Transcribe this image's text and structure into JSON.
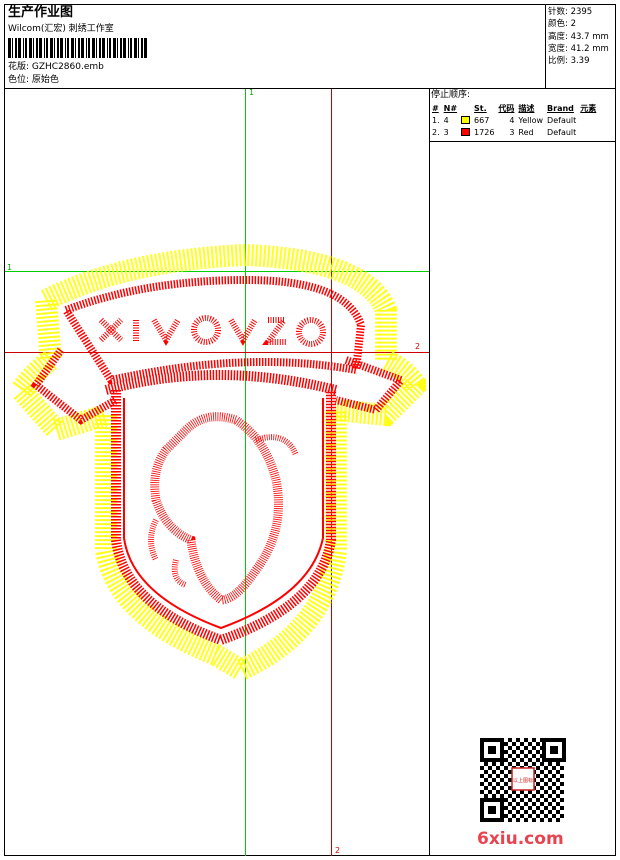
{
  "header": {
    "title": "生产作业图",
    "subtitle": "Wilcom(汇宏) 刺绣工作室",
    "design_label": "花版: GZHC2860.emb",
    "color_label": "色位: 原始色"
  },
  "specs": [
    "针数: 2395",
    "颜色: 2",
    "高度: 43.7 mm",
    "宽度: 41.2 mm",
    "比例: 3.39"
  ],
  "stop_sequence": {
    "title": "停止顺序:",
    "columns": [
      "#",
      "N#",
      "St.",
      "代码",
      "描述",
      "Brand",
      "元素"
    ],
    "rows": [
      {
        "idx": "1.",
        "n": "4",
        "color": "#ffff00",
        "stitches": "667",
        "code": "4",
        "desc": "Yellow",
        "brand": "Default",
        "element": ""
      },
      {
        "idx": "2.",
        "n": "3",
        "color": "#ff0000",
        "stitches": "1726",
        "code": "3",
        "desc": "Red",
        "brand": "Default",
        "element": ""
      }
    ]
  },
  "axes": {
    "v1": "1",
    "h1": "1",
    "h2": "2",
    "v2": "2"
  },
  "colors": {
    "green_guide": "#00cc00",
    "red_guide": "#cc0000",
    "thread_yellow": "#ffff00",
    "thread_red": "#ff0000"
  },
  "watermark": {
    "site": "6xiu.com",
    "seal_text": "以上图标"
  }
}
